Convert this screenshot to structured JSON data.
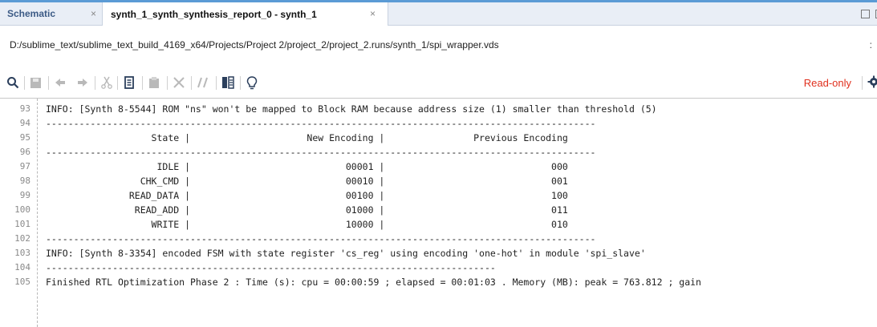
{
  "tabs": [
    {
      "label": "Schematic",
      "close": "×"
    },
    {
      "label": "synth_1_synth_synthesis_report_0 - synth_1",
      "close": "×"
    }
  ],
  "path": "D:/sublime_text/sublime_text_build_4169_x64/Projects/Project 2/project_2/project_2.runs/synth_1/spi_wrapper.vds",
  "path_overflow": ":",
  "toolbar": {
    "icons": [
      "search-icon",
      "save-icon",
      "undo-icon",
      "redo-icon",
      "cut-icon",
      "copy-icon",
      "paste-icon",
      "delete-icon",
      "comment-icon",
      "split-view-icon",
      "bulb-icon"
    ],
    "readonly_label": "Read-only",
    "settings_icon": "gear-icon"
  },
  "editor": {
    "lines": [
      {
        "num": "93",
        "text": "INFO: [Synth 8-5544] ROM \"ns\" won't be mapped to Block RAM because address size (1) smaller than threshold (5)"
      },
      {
        "num": "94",
        "text": "---------------------------------------------------------------------------------------------------"
      },
      {
        "num": "95",
        "text": "                   State |                     New Encoding |                Previous Encoding"
      },
      {
        "num": "96",
        "text": "---------------------------------------------------------------------------------------------------"
      },
      {
        "num": "97",
        "text": "                    IDLE |                            00001 |                              000"
      },
      {
        "num": "98",
        "text": "                 CHK_CMD |                            00010 |                              001"
      },
      {
        "num": "99",
        "text": "               READ_DATA |                            00100 |                              100"
      },
      {
        "num": "100",
        "text": "                READ_ADD |                            01000 |                              011"
      },
      {
        "num": "101",
        "text": "                   WRITE |                            10000 |                              010"
      },
      {
        "num": "102",
        "text": "---------------------------------------------------------------------------------------------------"
      },
      {
        "num": "103",
        "text": "INFO: [Synth 8-3354] encoded FSM with state register 'cs_reg' using encoding 'one-hot' in module 'spi_slave'"
      },
      {
        "num": "104",
        "text": "---------------------------------------------------------------------------------"
      },
      {
        "num": "105",
        "text": "Finished RTL Optimization Phase 2 : Time (s): cpu = 00:00:59 ; elapsed = 00:01:03 . Memory (MB): peak = 763.812 ; gain"
      }
    ]
  }
}
